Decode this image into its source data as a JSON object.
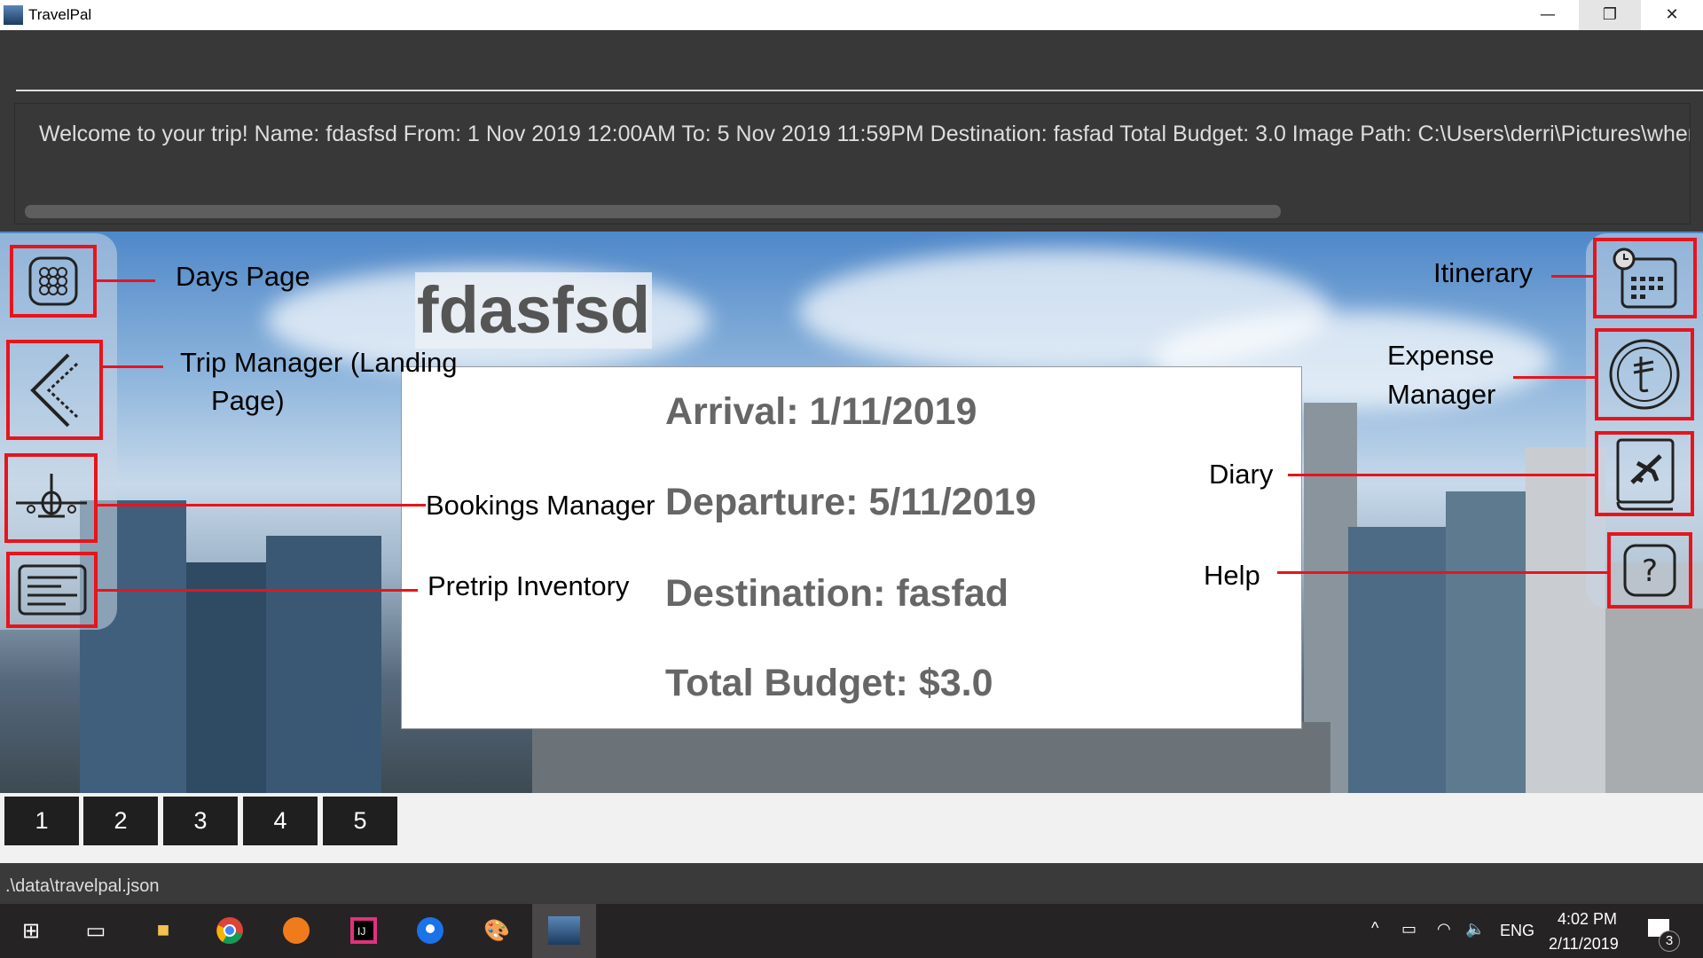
{
  "window": {
    "title": "TravelPal",
    "controls": [
      "minimize",
      "restore",
      "close"
    ]
  },
  "command_box": {
    "value": ""
  },
  "result_display": {
    "text": "Welcome to your trip! Name: fdasfsd From: 1 Nov 2019 12:00AM To: 5 Nov 2019 11:59PM Destination: fasfad Total Budget: 3.0 Image Path: C:\\Users\\derri\\Pictures\\where-is-"
  },
  "left_nav": {
    "days_page": "Days Page",
    "trip_manager_line1": "Trip Manager (Landing",
    "trip_manager_line2": "Page)",
    "bookings_manager": "Bookings Manager",
    "pretrip_inventory": "Pretrip Inventory"
  },
  "right_nav": {
    "itinerary": "Itinerary",
    "expense_line1": "Expense",
    "expense_line2": "Manager",
    "diary": "Diary",
    "help": "Help"
  },
  "trip": {
    "name": "fdasfsd",
    "arrival": "Arrival: 1/11/2019",
    "departure": "Departure: 5/11/2019",
    "destination": "Destination: fasfad",
    "budget": "Total Budget: $3.0"
  },
  "days": [
    "1",
    "2",
    "3",
    "4",
    "5"
  ],
  "status_bar": {
    "path": ".\\data\\travelpal.json"
  },
  "taskbar": {
    "time": "4:02 PM",
    "date": "2/11/2019",
    "language": "ENG",
    "notifications": "3"
  },
  "colors": {
    "annotation": "#e8141c",
    "dark": "#383838"
  }
}
